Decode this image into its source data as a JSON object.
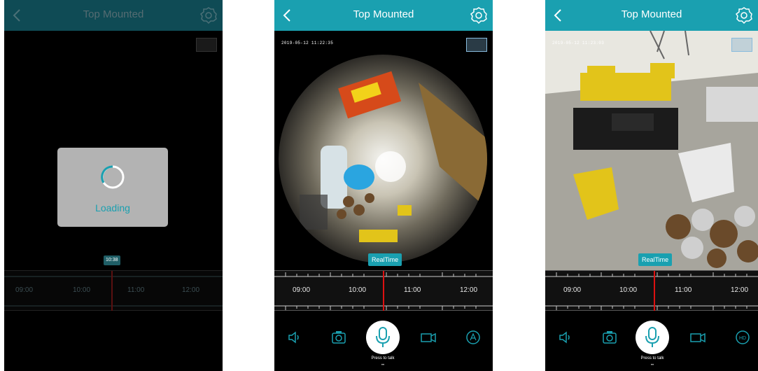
{
  "app": {
    "title": "Top Mounted",
    "back_icon": "chevron-left-icon",
    "settings_icon": "gear-icon"
  },
  "colors": {
    "accent": "#1aa0b0",
    "cursor": "#dd1111",
    "loading_panel": "#b3b3b3"
  },
  "screens": [
    {
      "title": "Top Mounted",
      "state": "loading",
      "loading_label": "Loading",
      "time_badge": "10:38",
      "timeline_labels": [
        "09:00",
        "10:00",
        "11:00",
        "12:00"
      ]
    },
    {
      "title": "Top Mounted",
      "state": "fisheye",
      "timestamp": "2019-05-12 11:22:35",
      "time_badge": "RealTime",
      "timeline_labels": [
        "09:00",
        "10:00",
        "11:00",
        "12:00"
      ],
      "press_to_talk": "Press to talk",
      "dots": "••"
    },
    {
      "title": "Top Mounted",
      "state": "dewarped",
      "timestamp": "2019-05-12 11:23:03",
      "time_badge": "RealTime",
      "timeline_labels": [
        "09:00",
        "10:00",
        "11:00",
        "12:00"
      ],
      "press_to_talk": "Press to talk",
      "dots": "••"
    }
  ],
  "controls": {
    "icons": [
      "speaker-icon",
      "camera-icon",
      "microphone-icon",
      "video-record-icon",
      "mode-icon"
    ]
  }
}
